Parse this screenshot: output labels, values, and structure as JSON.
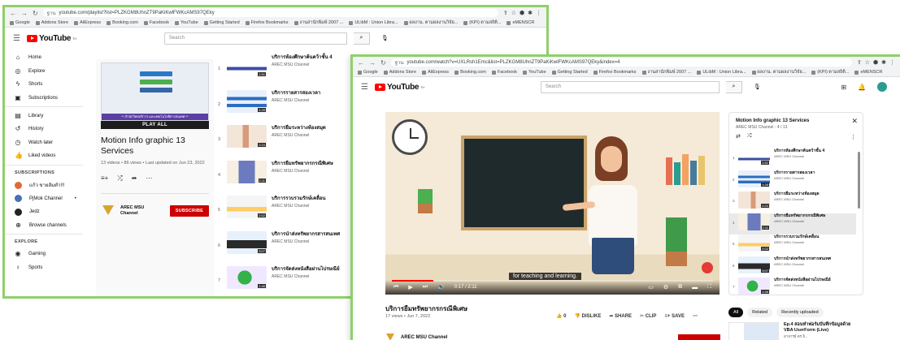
{
  "windowA": {
    "url": "youtube.com/playlist?list=PLZKGM8UhnZT9PaKiKwlFWKcAMS97QEky",
    "url_scheme": "ฐาน",
    "bookmarks": [
      "Google",
      "Addons Store",
      "AliExpress",
      "Booking.com",
      "Facebook",
      "YouTube",
      "Getting Started",
      "Firefox Bookmarks",
      "งานสานักพิมพ์ 2007 ...",
      "ULibM : Union Libra...",
      "ผลงาน. ตามผลงานวิจัย...",
      "(KPI) ตามสถิติ...",
      "eMENSCR"
    ],
    "search_placeholder": "Search",
    "sidebar": [
      {
        "icon": "home-icon",
        "glyph": "⌂",
        "label": "Home"
      },
      {
        "icon": "explore-icon",
        "glyph": "◎",
        "label": "Explore"
      },
      {
        "icon": "shorts-icon",
        "glyph": "ϟ",
        "label": "Shorts"
      },
      {
        "icon": "subscriptions-icon",
        "glyph": "▣",
        "label": "Subscriptions"
      }
    ],
    "sidebar2": [
      {
        "icon": "library-icon",
        "glyph": "▤",
        "label": "Library"
      },
      {
        "icon": "history-icon",
        "glyph": "↺",
        "label": "History"
      },
      {
        "icon": "watch-later-icon",
        "glyph": "◷",
        "label": "Watch later"
      },
      {
        "icon": "liked-videos-icon",
        "glyph": "👍",
        "label": "Liked videos"
      }
    ],
    "subscriptions_label": "SUBSCRIPTIONS",
    "subscriptions": [
      {
        "label": "แก้ว ขายส้มตำ!!!",
        "color": "#e06a3b"
      },
      {
        "label": "PjMok Channel",
        "color": "#4a6fb5",
        "dot": "•"
      },
      {
        "label": "Jedz",
        "color": "#222222"
      },
      {
        "label": "Browse channels",
        "color": "#ffffff",
        "glyph": "⊕"
      }
    ],
    "explore_label": "EXPLORE",
    "explore": [
      {
        "icon": "gaming-icon",
        "glyph": "◉",
        "label": "Gaming"
      },
      {
        "icon": "sports-icon",
        "glyph": "♀",
        "label": "Sports"
      }
    ],
    "playlist": {
      "thumb_caption": "** สำนักวิทยบริการ และเทคโนโลยีสารสนเทศ **",
      "play_all": "PLAY ALL",
      "title": "Motion Info graphic 13 Services",
      "meta": "13 videos • 86 views • Last updated on Jun 23, 2022",
      "channel": "AREC MSU Channel",
      "subscribe": "SUBSCRIBE"
    },
    "videos": [
      {
        "n": "1",
        "title": "บริการห้องศึกษาค้นคว้าชั้น 4",
        "channel": "AREC MSU Channel",
        "dur": "1:51",
        "thumb": "th1"
      },
      {
        "n": "2",
        "title": "บริการรายสารสองเวลา",
        "channel": "AREC MSU Channel",
        "dur": "1:28",
        "thumb": "th2"
      },
      {
        "n": "3",
        "title": "บริการยืมระหว่างห้องสมุด",
        "channel": "AREC MSU Channel",
        "dur": "2:24",
        "thumb": "th3"
      },
      {
        "n": "4",
        "title": "บริการยืมทรัพยากรกรณีพิเศษ",
        "channel": "AREC MSU Channel",
        "dur": "2:11",
        "thumb": "th4"
      },
      {
        "n": "5",
        "title": "บริการรวบรวมรักษ์เคลื่อน",
        "channel": "AREC MSU Channel",
        "dur": "2:02",
        "thumb": "th5"
      },
      {
        "n": "6",
        "title": "บริการนำส่งทรัพยากรสารสนเทศ",
        "channel": "AREC MSU Channel",
        "dur": "3:07",
        "thumb": "th6"
      },
      {
        "n": "7",
        "title": "บริการจัดส่งหนังสือผ่านไปรษณีย์",
        "channel": "AREC MSU Channel",
        "dur": "1:46",
        "thumb": "th7"
      }
    ]
  },
  "windowB": {
    "url": "youtube.com/watch?v=UXLRsh1Emc&list=PLZKGM8UhnZT9PaKiKwlFWKcAMS97QEky&index=4",
    "url_scheme": "ฐาน",
    "bookmarks": [
      "Google",
      "Addons Store",
      "AliExpress",
      "Booking.com",
      "Facebook",
      "YouTube",
      "Getting Started",
      "Firefox Bookmarks",
      "งานสานักพิมพ์ 2007 ...",
      "ULibM : Union Libra...",
      "ผลงาน. ตามผลงานวิจัย...",
      "(KPI) ตามสถิติ...",
      "eMENSCR"
    ],
    "search_placeholder": "Search",
    "player": {
      "time": "0:17 / 2:11",
      "subtitle": "for teaching and learning.",
      "progress": 0.13
    },
    "video_title": "บริการยืมทรัพยากรกรณีพิเศษ",
    "video_meta": "17 views • Jun 7, 2022",
    "likes": "0",
    "dislike": "DISLIKE",
    "share": "SHARE",
    "clip": "CLIP",
    "save": "SAVE",
    "channel": "AREC MSU Channel",
    "subscribe": "SUBSCRIBE",
    "playlist": {
      "title": "Motion Info graphic 13 Services",
      "sub": "AREC MSU Channel - 4 / 13",
      "current_index": 4
    },
    "chips": [
      "All",
      "Related",
      "Recently uploaded"
    ],
    "rec": {
      "title": "Ep.4 สอนทำฟอร์มบันทึกข้อมูลด้วย VBA UserForm (Live)",
      "channel": "อาจารย์ ดร.จิ..."
    }
  },
  "colors": {
    "accent": "#ff0000",
    "frame": "#8fd06a",
    "subscribe": "#cc0000"
  }
}
